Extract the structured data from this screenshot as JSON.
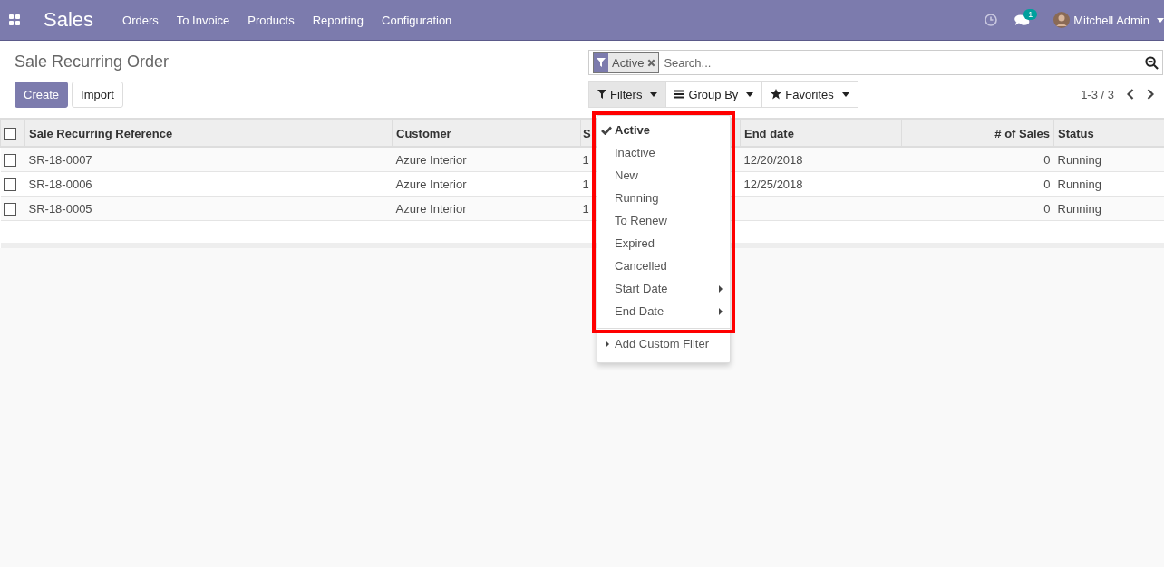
{
  "navbar": {
    "app_title": "Sales",
    "menu": [
      "Orders",
      "To Invoice",
      "Products",
      "Reporting",
      "Configuration"
    ],
    "messages_badge": "1",
    "user": "Mitchell Admin"
  },
  "breadcrumb": "Sale Recurring Order",
  "buttons": {
    "create": "Create",
    "import": "Import"
  },
  "search": {
    "facet": "Active",
    "placeholder": "Search..."
  },
  "search_buttons": [
    {
      "label": "Filters",
      "kind": "funnel",
      "selected": true
    },
    {
      "label": "Group By",
      "kind": "bars",
      "selected": false
    },
    {
      "label": "Favorites",
      "kind": "star",
      "selected": false
    }
  ],
  "pager": "1-3 / 3",
  "table": {
    "select_all_checked": false,
    "columns": [
      "Sale Recurring Reference",
      "Customer",
      "S",
      "End date",
      "# of Sales",
      "Status"
    ],
    "rows": [
      {
        "checked": false,
        "reference": "SR-18-0007",
        "customer": "Azure Interior",
        "column_3": "1",
        "end_date": "12/20/2018",
        "sales": "0",
        "status": "Running"
      },
      {
        "checked": false,
        "reference": "SR-18-0006",
        "customer": "Azure Interior",
        "column_3": "1",
        "end_date": "12/25/2018",
        "sales": "0",
        "status": "Running"
      },
      {
        "checked": false,
        "reference": "SR-18-0005",
        "customer": "Azure Interior",
        "column_3": "1",
        "sales": "0",
        "status": "Running"
      }
    ]
  },
  "filters_menu": {
    "items": [
      {
        "label": "Active",
        "checked": true,
        "submenu": false
      },
      {
        "label": "Inactive",
        "checked": false,
        "submenu": false
      },
      {
        "label": "New",
        "checked": false,
        "submenu": false
      },
      {
        "label": "Running",
        "checked": false,
        "submenu": false
      },
      {
        "label": "To Renew",
        "checked": false,
        "submenu": false
      },
      {
        "label": "Expired",
        "checked": false,
        "submenu": false
      },
      {
        "label": "Cancelled",
        "checked": false,
        "submenu": false
      },
      {
        "label": "Start Date",
        "checked": false,
        "submenu": true
      },
      {
        "label": "End Date",
        "checked": false,
        "submenu": true
      }
    ],
    "custom": "Add Custom Filter"
  }
}
